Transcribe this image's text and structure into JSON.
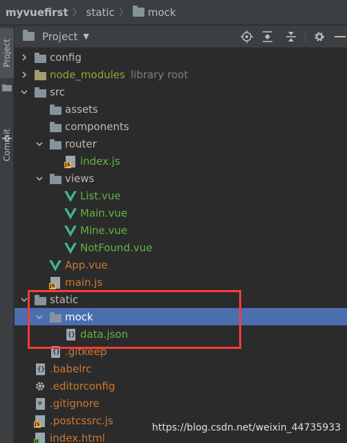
{
  "breadcrumb": {
    "items": [
      "myvuefirst",
      "static",
      "mock"
    ]
  },
  "tool_strip": {
    "project_tab": "Project",
    "commit_tab": "Commit"
  },
  "panel": {
    "title": "Project",
    "dropdown_icon": "chevron-down-icon",
    "buttons": [
      "locate-icon",
      "expand-all-icon",
      "collapse-all-icon",
      "gear-icon",
      "hide-icon"
    ]
  },
  "tree": [
    {
      "label": "config",
      "type": "folder",
      "depth": 1,
      "expandable": true,
      "expanded": false,
      "color": "#bbbbbb"
    },
    {
      "label": "node_modules",
      "type": "folder-lib",
      "depth": 1,
      "expandable": true,
      "expanded": false,
      "color": "#a0a03a",
      "suffix": "library root"
    },
    {
      "label": "src",
      "type": "folder",
      "depth": 1,
      "expandable": true,
      "expanded": true,
      "color": "#bbbbbb"
    },
    {
      "label": "assets",
      "type": "folder",
      "depth": 2,
      "expandable": false,
      "color": "#bbbbbb"
    },
    {
      "label": "components",
      "type": "folder",
      "depth": 2,
      "expandable": false,
      "color": "#bbbbbb"
    },
    {
      "label": "router",
      "type": "folder",
      "depth": 2,
      "expandable": true,
      "expanded": true,
      "color": "#bbbbbb"
    },
    {
      "label": "index.js",
      "type": "js",
      "depth": 3,
      "expandable": false,
      "color": "#62b543"
    },
    {
      "label": "views",
      "type": "folder",
      "depth": 2,
      "expandable": true,
      "expanded": true,
      "color": "#bbbbbb"
    },
    {
      "label": "List.vue",
      "type": "vue",
      "depth": 3,
      "expandable": false,
      "color": "#62b543"
    },
    {
      "label": "Main.vue",
      "type": "vue",
      "depth": 3,
      "expandable": false,
      "color": "#62b543"
    },
    {
      "label": "Mine.vue",
      "type": "vue",
      "depth": 3,
      "expandable": false,
      "color": "#62b543"
    },
    {
      "label": "NotFound.vue",
      "type": "vue",
      "depth": 3,
      "expandable": false,
      "color": "#62b543"
    },
    {
      "label": "App.vue",
      "type": "vue",
      "depth": 2,
      "expandable": false,
      "color": "#cc7832"
    },
    {
      "label": "main.js",
      "type": "js",
      "depth": 2,
      "expandable": false,
      "color": "#cc7832"
    },
    {
      "label": "static",
      "type": "folder",
      "depth": 1,
      "expandable": true,
      "expanded": true,
      "color": "#bbbbbb"
    },
    {
      "label": "mock",
      "type": "folder",
      "depth": 2,
      "expandable": true,
      "expanded": true,
      "color": "#bbbbbb",
      "selected": true
    },
    {
      "label": "data.json",
      "type": "json",
      "depth": 3,
      "expandable": false,
      "color": "#62b543"
    },
    {
      "label": ".gitkeep",
      "type": "json",
      "depth": 2,
      "expandable": false,
      "color": "#cc7832"
    },
    {
      "label": ".babelrc",
      "type": "json",
      "depth": 1,
      "expandable": false,
      "color": "#cc7832"
    },
    {
      "label": ".editorconfig",
      "type": "gear",
      "depth": 1,
      "expandable": false,
      "color": "#cc7832"
    },
    {
      "label": ".gitignore",
      "type": "gitignore",
      "depth": 1,
      "expandable": false,
      "color": "#cc7832"
    },
    {
      "label": ".postcssrc.js",
      "type": "js",
      "depth": 1,
      "expandable": false,
      "color": "#cc7832"
    },
    {
      "label": "index.html",
      "type": "html",
      "depth": 1,
      "expandable": false,
      "color": "#cc7832"
    }
  ],
  "watermark": "https://blog.csdn.net/weixin_44735933",
  "colors": {
    "selection": "#4b6eaf",
    "annotation_box": "#ff3b3b",
    "vue_green": "#41b883"
  }
}
